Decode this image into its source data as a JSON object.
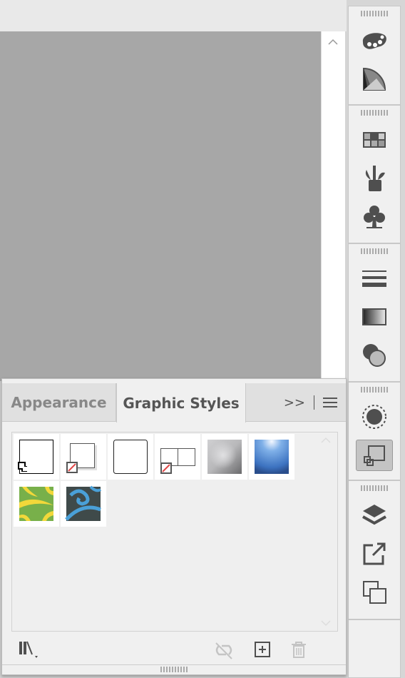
{
  "panel": {
    "tabs": [
      {
        "label": "Appearance",
        "active": false
      },
      {
        "label": "Graphic Styles",
        "active": true
      }
    ],
    "overflow_icon": "double-chevron-right",
    "menu_icon": "hamburger-menu",
    "styles": [
      {
        "name": "default-style"
      },
      {
        "name": "drop-shadow-style"
      },
      {
        "name": "rounded-corners-style"
      },
      {
        "name": "no-fill-style"
      },
      {
        "name": "gray-bevel-style"
      },
      {
        "name": "blue-gloss-style"
      },
      {
        "name": "green-yellow-pattern-style"
      },
      {
        "name": "blue-swirl-pattern-style"
      }
    ],
    "footer_icons": [
      "libraries-menu-icon",
      "break-link-icon",
      "new-style-icon",
      "trash-icon"
    ]
  },
  "dock": {
    "icons": [
      "palette",
      "color-guide",
      "swatches",
      "brushes",
      "symbols",
      "stroke",
      "gradient",
      "transparency",
      "appearance",
      "graphic-styles",
      "layers",
      "export",
      "artboards"
    ],
    "active": "graphic-styles"
  },
  "colors": {
    "canvas": "#a7a7a7",
    "panel": "#f0f0f0",
    "icon": "#555555",
    "red_slash": "#e04848"
  }
}
